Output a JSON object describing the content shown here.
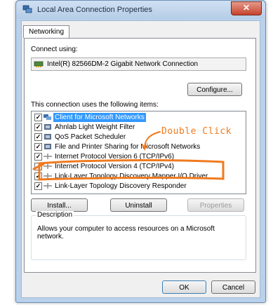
{
  "window": {
    "title": "Local Area Connection Properties",
    "close_label": "✕"
  },
  "tabs": [
    {
      "label": "Networking",
      "active": true
    }
  ],
  "connect_using": {
    "label": "Connect using:",
    "adapter": "Intel(R) 82566DM-2 Gigabit Network Connection",
    "configure_label": "Configure..."
  },
  "items_section": {
    "label": "This connection uses the following items:",
    "items": [
      {
        "label": "Client for Microsoft Networks",
        "checked": true,
        "selected": true,
        "icon": "network-client-icon"
      },
      {
        "label": "Ahnlab Light Weight Filter",
        "checked": true,
        "selected": false,
        "icon": "service-icon"
      },
      {
        "label": "QoS Packet Scheduler",
        "checked": true,
        "selected": false,
        "icon": "service-icon"
      },
      {
        "label": "File and Printer Sharing for Microsoft Networks",
        "checked": true,
        "selected": false,
        "icon": "service-icon"
      },
      {
        "label": "Internet Protocol Version 6 (TCP/IPv6)",
        "checked": true,
        "selected": false,
        "icon": "protocol-icon"
      },
      {
        "label": "Internet Protocol Version 4 (TCP/IPv4)",
        "checked": true,
        "selected": false,
        "icon": "protocol-icon"
      },
      {
        "label": "Link-Layer Topology Discovery Mapper I/O Driver",
        "checked": true,
        "selected": false,
        "icon": "protocol-icon"
      },
      {
        "label": "Link-Layer Topology Discovery Responder",
        "checked": true,
        "selected": false,
        "icon": "protocol-icon"
      }
    ],
    "install_label": "Install...",
    "uninstall_label": "Uninstall",
    "properties_label": "Properties"
  },
  "description": {
    "title": "Description",
    "text": "Allows your computer to access resources on a Microsoft network."
  },
  "footer": {
    "ok_label": "OK",
    "cancel_label": "Cancel"
  },
  "annotation": {
    "text": "Double Click",
    "color": "#f07a1e"
  },
  "colors": {
    "selection": "#3399ff",
    "titlebar": "#b9d1ea"
  }
}
